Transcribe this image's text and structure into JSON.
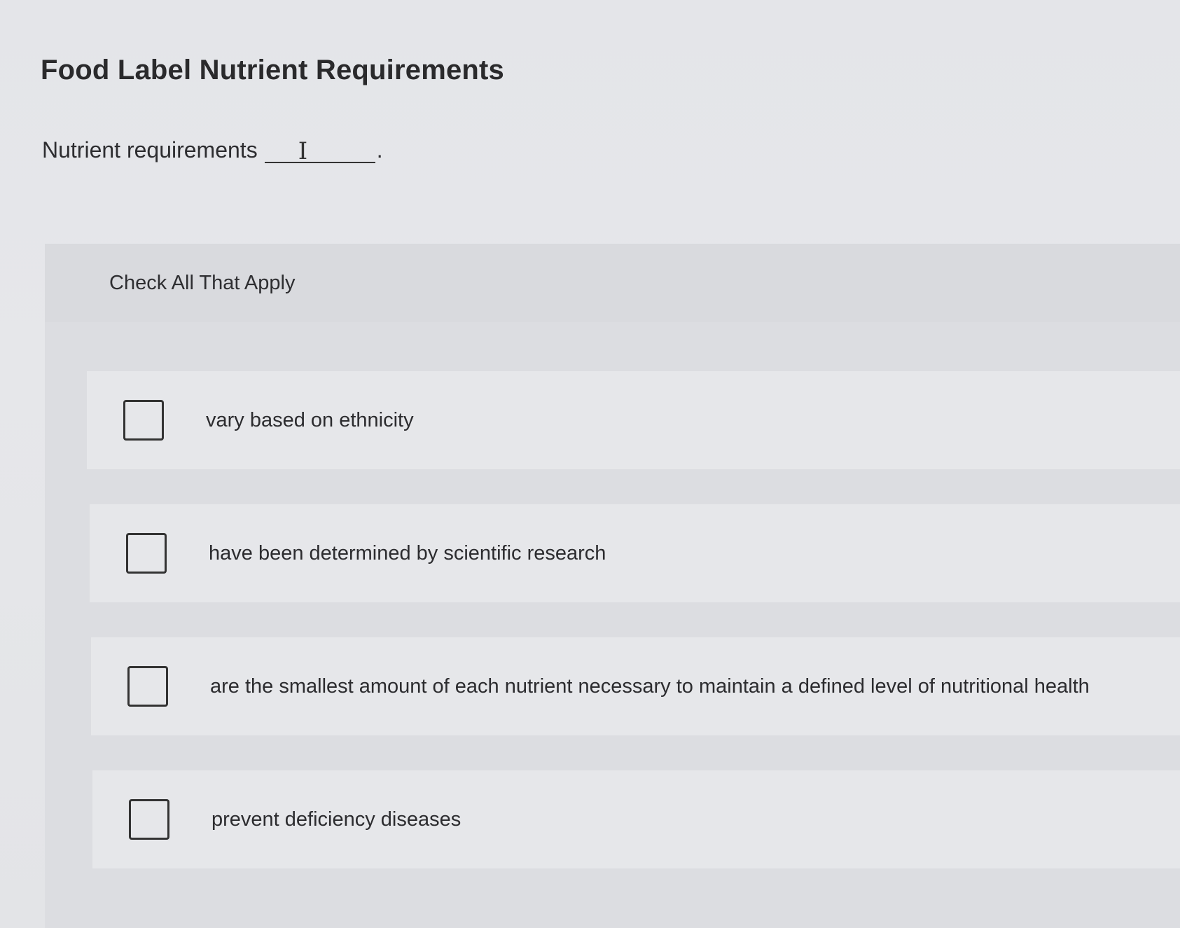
{
  "question": {
    "title": "Food Label Nutrient Requirements",
    "prompt_text": "Nutrient requirements",
    "prompt_end": ".",
    "instructions": "Check All That Apply"
  },
  "options": [
    {
      "label": "vary based on ethnicity",
      "checked": false
    },
    {
      "label": "have been determined by scientific research",
      "checked": false
    },
    {
      "label": "are the smallest amount of each nutrient necessary to maintain a defined level of nutritional health",
      "checked": false
    },
    {
      "label": "prevent deficiency diseases",
      "checked": false
    }
  ]
}
